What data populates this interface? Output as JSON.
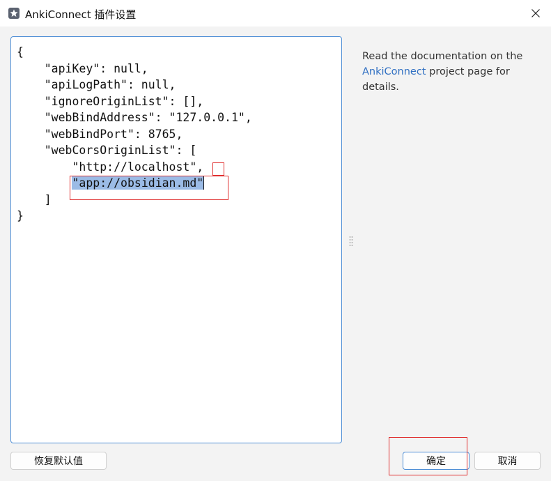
{
  "window": {
    "title": "AnkiConnect 插件设置",
    "app_icon": "anki-star-icon",
    "close_icon": "close-icon"
  },
  "editor": {
    "lines": [
      "{",
      "    \"apiKey\": null,",
      "    \"apiLogPath\": null,",
      "    \"ignoreOriginList\": [],",
      "    \"webBindAddress\": \"127.0.0.1\",",
      "    \"webBindPort\": 8765,",
      "    \"webCorsOriginList\": [",
      "        \"http://localhost\"",
      ",",
      "        ",
      "\"app://obsidian.md\"",
      "    ]",
      "}"
    ],
    "selected_text": "\"app://obsidian.md\"",
    "selection_color": "#9bbbe6",
    "border_color": "#4f8fd6"
  },
  "help": {
    "text_before": "Read the documentation on the ",
    "link_text": "AnkiConnect",
    "text_after": " project page for details.",
    "link_color": "#2f6fc2"
  },
  "buttons": {
    "reset": "恢复默认值",
    "ok": "确定",
    "cancel": "取消"
  },
  "annotations": {
    "highlight_color": "#e03030"
  }
}
